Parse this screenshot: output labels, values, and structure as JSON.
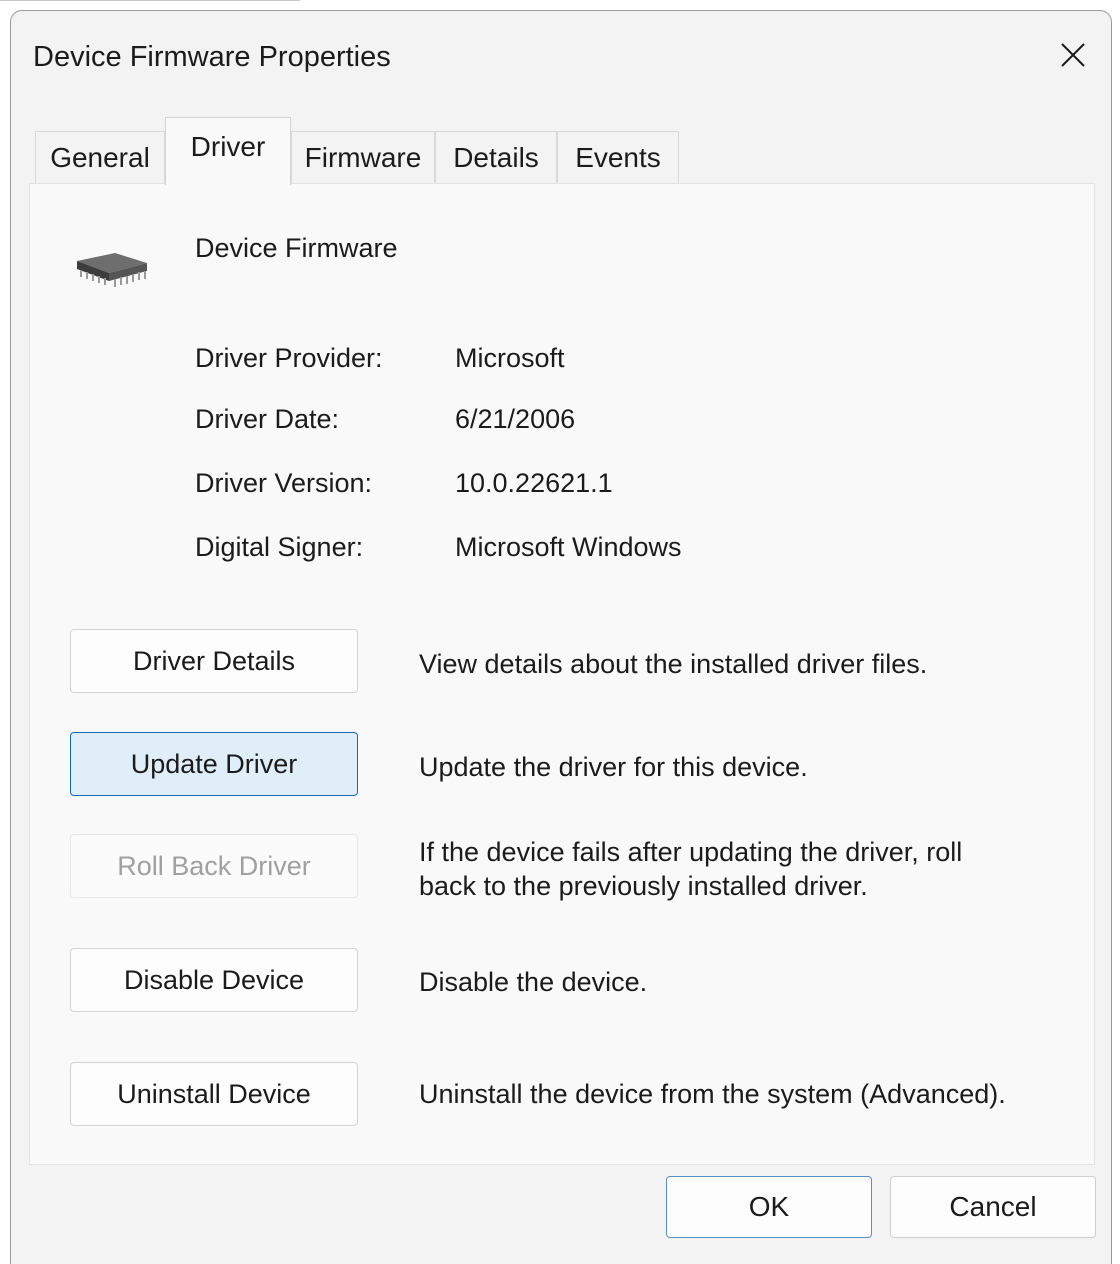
{
  "window": {
    "title": "Device Firmware Properties"
  },
  "tabs": [
    {
      "label": "General"
    },
    {
      "label": "Driver"
    },
    {
      "label": "Firmware"
    },
    {
      "label": "Details"
    },
    {
      "label": "Events"
    }
  ],
  "active_tab": "Driver",
  "device": {
    "name": "Device Firmware",
    "icon": "chip-icon"
  },
  "properties": [
    {
      "label": "Driver Provider:",
      "value": "Microsoft"
    },
    {
      "label": "Driver Date:",
      "value": "6/21/2006"
    },
    {
      "label": "Driver Version:",
      "value": "10.0.22621.1"
    },
    {
      "label": "Digital Signer:",
      "value": "Microsoft Windows"
    }
  ],
  "actions": [
    {
      "label": "Driver Details",
      "description": "View details about the installed driver files.",
      "state": "normal"
    },
    {
      "label": "Update Driver",
      "description": "Update the driver for this device.",
      "state": "focused"
    },
    {
      "label": "Roll Back Driver",
      "description_line1": "If the device fails after updating the driver, roll",
      "description_line2": "back to the previously installed driver.",
      "state": "disabled"
    },
    {
      "label": "Disable Device",
      "description": "Disable the device.",
      "state": "normal"
    },
    {
      "label": "Uninstall Device",
      "description": "Uninstall the device from the system (Advanced).",
      "state": "normal"
    }
  ],
  "footer": {
    "ok_label": "OK",
    "cancel_label": "Cancel"
  },
  "colors": {
    "accent": "#0f6cbd",
    "focused_fill": "#e0eef9",
    "disabled_text": "#a0a0a0"
  }
}
